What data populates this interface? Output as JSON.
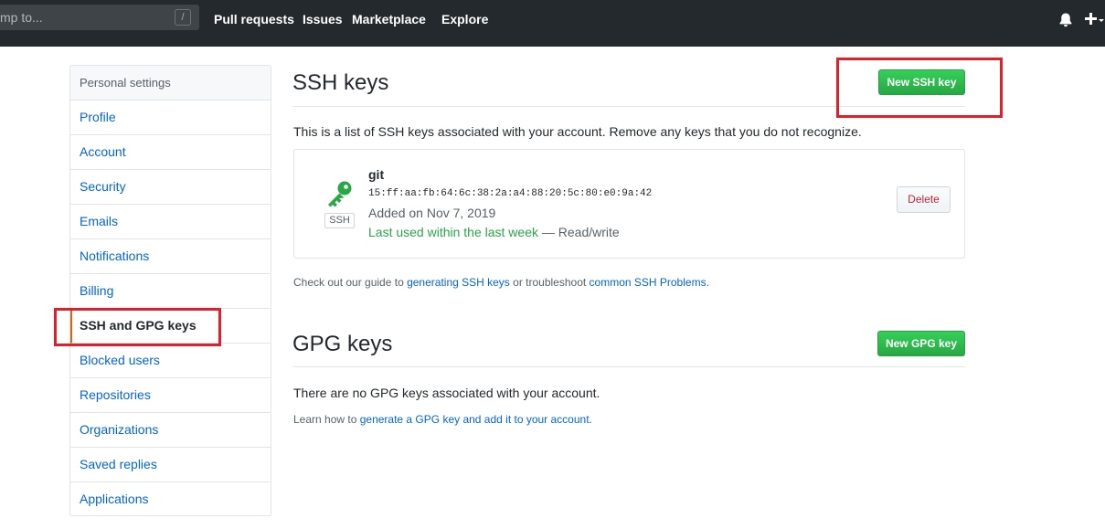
{
  "header": {
    "search_placeholder": "mp to...",
    "search_shortcut": "/",
    "nav": [
      "Pull requests",
      "Issues",
      "Marketplace",
      "Explore"
    ]
  },
  "sidebar": {
    "header": "Personal settings",
    "items": [
      {
        "label": "Profile"
      },
      {
        "label": "Account"
      },
      {
        "label": "Security"
      },
      {
        "label": "Emails"
      },
      {
        "label": "Notifications"
      },
      {
        "label": "Billing"
      },
      {
        "label": "SSH and GPG keys",
        "selected": true
      },
      {
        "label": "Blocked users"
      },
      {
        "label": "Repositories"
      },
      {
        "label": "Organizations"
      },
      {
        "label": "Saved replies"
      },
      {
        "label": "Applications"
      }
    ]
  },
  "ssh": {
    "title": "SSH keys",
    "new_button": "New SSH key",
    "intro": "This is a list of SSH keys associated with your account. Remove any keys that you do not recognize.",
    "key": {
      "icon": "key-icon",
      "badge": "SSH",
      "title": "git",
      "fingerprint": "15:ff:aa:fb:64:6c:38:2a:a4:88:20:5c:80:e0:9a:42",
      "added": "Added on Nov 7, 2019",
      "last_used": "Last used within the last week",
      "access": " — Read/write",
      "delete_button": "Delete"
    },
    "footer_prefix": "Check out our guide to ",
    "footer_link1": "generating SSH keys",
    "footer_middle": " or troubleshoot ",
    "footer_link2": "common SSH Problems",
    "footer_suffix": "."
  },
  "gpg": {
    "title": "GPG keys",
    "new_button": "New GPG key",
    "empty": "There are no GPG keys associated with your account.",
    "footer_prefix": "Learn how to ",
    "footer_link": "generate a GPG key and add it to your account",
    "footer_suffix": "."
  },
  "colors": {
    "annotation": "#e01f2a",
    "accent": "#e36209",
    "link": "#0366d6",
    "primary": "#2ea44f"
  }
}
